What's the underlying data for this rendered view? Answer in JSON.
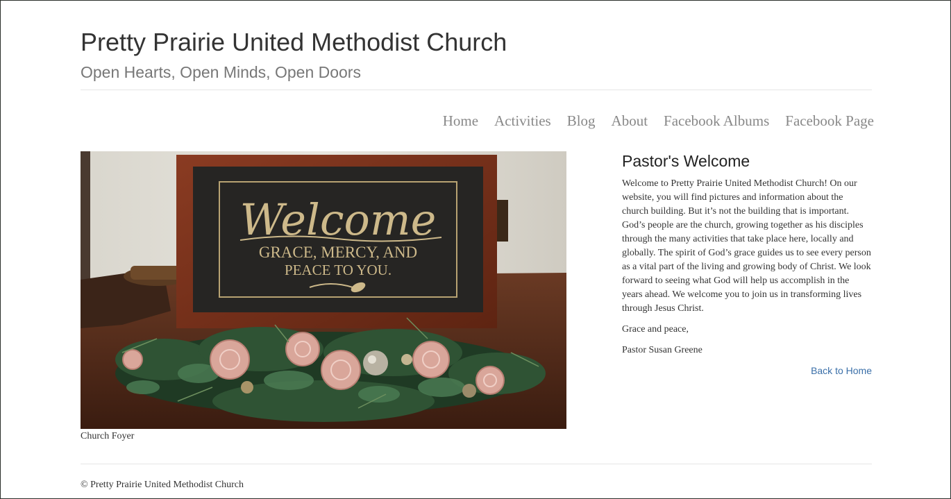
{
  "header": {
    "site_title": "Pretty Prairie United Methodist Church",
    "tagline": "Open Hearts, Open Minds, Open Doors"
  },
  "nav": {
    "items": [
      {
        "label": "Home"
      },
      {
        "label": "Activities"
      },
      {
        "label": "Blog"
      },
      {
        "label": "About"
      },
      {
        "label": "Facebook Albums"
      },
      {
        "label": "Facebook Page"
      }
    ]
  },
  "feature": {
    "sign_script": "Welcome",
    "sign_line1": "GRACE, MERCY, AND",
    "sign_line2": "PEACE TO YOU.",
    "caption": "Church Foyer"
  },
  "welcome": {
    "heading": "Pastor's Welcome",
    "body": "Welcome to Pretty Prairie United Methodist Church! On our website, you will find pictures and information about the church building. But it’s not the building that is important. God’s people are the church, growing together as his disciples through the many activities that take place here, locally and globally. The spirit of God’s grace guides us to see every person as a vital part of the living and growing body of Christ. We look forward to seeing what God will help us accomplish in the years ahead. We welcome you to join us in transforming lives through Jesus Christ.",
    "closing": "Grace and peace,",
    "signature": "Pastor Susan Greene",
    "back_link": "Back to Home"
  },
  "footer": {
    "copyright": "© Pretty Prairie United Methodist Church"
  },
  "colors": {
    "nav_text": "#888888",
    "link": "#3a6fa8",
    "tagline": "#777777"
  }
}
